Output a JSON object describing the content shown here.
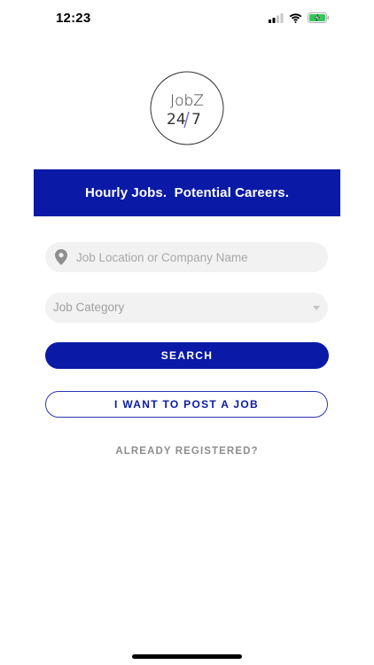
{
  "status_bar": {
    "time": "12:23",
    "icons": [
      "signal-icon",
      "wifi-icon",
      "battery-charging-icon"
    ],
    "battery_color": "#34c759"
  },
  "logo": {
    "line1": "JobZ",
    "line2": "24/7",
    "accent_color": "#7c6bd6"
  },
  "banner": {
    "text": "Hourly Jobs.  Potential Careers."
  },
  "search": {
    "placeholder": "Job Location or Company Name",
    "value": ""
  },
  "category": {
    "selected": "Job Category"
  },
  "buttons": {
    "search_label": "SEARCH",
    "post_job_label": "I WANT TO POST A JOB"
  },
  "links": {
    "already_registered": "ALREADY REGISTERED?"
  },
  "colors": {
    "brand": "#0a1aa6",
    "field_bg": "#f2f2f2",
    "muted_text": "#8e8e8e"
  }
}
